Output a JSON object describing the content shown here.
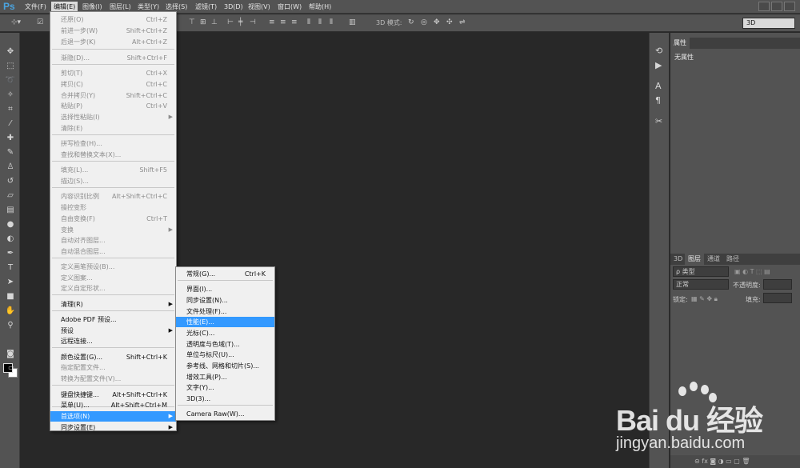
{
  "app": {
    "logo": "Ps"
  },
  "menubar": {
    "items": [
      "文件(F)",
      "编辑(E)",
      "图像(I)",
      "图层(L)",
      "类型(Y)",
      "选择(S)",
      "滤镜(T)",
      "3D(D)",
      "视图(V)",
      "窗口(W)",
      "帮助(H)"
    ],
    "active_index": 1
  },
  "optbar": {
    "mode_label": "3D 模式:",
    "workspace": "3D"
  },
  "panels": {
    "properties_tab": "属性",
    "no_properties": "无属性",
    "layer_tabs": [
      "3D",
      "图层",
      "通道",
      "路径"
    ],
    "layer_tab_active": 1,
    "kind_filter": "ρ 类型",
    "blend_mode": "正常",
    "opacity_label": "不透明度:",
    "lock_label": "锁定:",
    "fill_label": "填充:"
  },
  "edit_menu": {
    "items": [
      {
        "label": "还原(O)",
        "shortcut": "Ctrl+Z",
        "disabled": true
      },
      {
        "label": "前进一步(W)",
        "shortcut": "Shift+Ctrl+Z",
        "disabled": true
      },
      {
        "label": "后退一步(K)",
        "shortcut": "Alt+Ctrl+Z",
        "disabled": true
      },
      {
        "label": "渐隐(D)...",
        "shortcut": "Shift+Ctrl+F",
        "disabled": true
      },
      {
        "label": "剪切(T)",
        "shortcut": "Ctrl+X",
        "disabled": true
      },
      {
        "label": "拷贝(C)",
        "shortcut": "Ctrl+C",
        "disabled": true
      },
      {
        "label": "合并拷贝(Y)",
        "shortcut": "Shift+Ctrl+C",
        "disabled": true
      },
      {
        "label": "粘贴(P)",
        "shortcut": "Ctrl+V",
        "disabled": true
      },
      {
        "label": "选择性粘贴(I)",
        "shortcut": "",
        "disabled": true,
        "submenu": true
      },
      {
        "label": "清除(E)",
        "shortcut": "",
        "disabled": true
      },
      {
        "label": "拼写检查(H)...",
        "shortcut": "",
        "disabled": true
      },
      {
        "label": "查找和替换文本(X)...",
        "shortcut": "",
        "disabled": true
      },
      {
        "label": "填充(L)...",
        "shortcut": "Shift+F5",
        "disabled": true
      },
      {
        "label": "描边(S)...",
        "shortcut": "",
        "disabled": true
      },
      {
        "label": "内容识别比例",
        "shortcut": "Alt+Shift+Ctrl+C",
        "disabled": true
      },
      {
        "label": "操控变形",
        "shortcut": "",
        "disabled": true
      },
      {
        "label": "自由变换(F)",
        "shortcut": "Ctrl+T",
        "disabled": true
      },
      {
        "label": "变换",
        "shortcut": "",
        "disabled": true,
        "submenu": true
      },
      {
        "label": "自动对齐图层...",
        "shortcut": "",
        "disabled": true
      },
      {
        "label": "自动混合图层...",
        "shortcut": "",
        "disabled": true
      },
      {
        "label": "定义画笔预设(B)...",
        "shortcut": "",
        "disabled": true
      },
      {
        "label": "定义图案...",
        "shortcut": "",
        "disabled": true
      },
      {
        "label": "定义自定形状...",
        "shortcut": "",
        "disabled": true
      },
      {
        "label": "清理(R)",
        "shortcut": "",
        "disabled": false,
        "submenu": true
      },
      {
        "label": "Adobe PDF 预设...",
        "shortcut": "",
        "disabled": false
      },
      {
        "label": "预设",
        "shortcut": "",
        "disabled": false,
        "submenu": true
      },
      {
        "label": "远程连接...",
        "shortcut": "",
        "disabled": false
      },
      {
        "label": "颜色设置(G)...",
        "shortcut": "Shift+Ctrl+K",
        "disabled": false
      },
      {
        "label": "指定配置文件...",
        "shortcut": "",
        "disabled": true
      },
      {
        "label": "转换为配置文件(V)...",
        "shortcut": "",
        "disabled": true
      },
      {
        "label": "键盘快捷键...",
        "shortcut": "Alt+Shift+Ctrl+K",
        "disabled": false
      },
      {
        "label": "菜单(U)...",
        "shortcut": "Alt+Shift+Ctrl+M",
        "disabled": false
      },
      {
        "label": "首选项(N)",
        "shortcut": "",
        "disabled": false,
        "submenu": true,
        "highlighted": true
      },
      {
        "label": "同步设置(E)",
        "shortcut": "",
        "disabled": false,
        "submenu": true
      }
    ]
  },
  "prefs_submenu": {
    "items": [
      {
        "label": "常规(G)...",
        "shortcut": "Ctrl+K"
      },
      {
        "label": "界面(I)...",
        "shortcut": ""
      },
      {
        "label": "同步设置(N)...",
        "shortcut": ""
      },
      {
        "label": "文件处理(F)...",
        "shortcut": ""
      },
      {
        "label": "性能(E)...",
        "shortcut": "",
        "highlighted": true
      },
      {
        "label": "光标(C)...",
        "shortcut": ""
      },
      {
        "label": "透明度与色域(T)...",
        "shortcut": ""
      },
      {
        "label": "单位与标尺(U)...",
        "shortcut": ""
      },
      {
        "label": "参考线、网格和切片(S)...",
        "shortcut": ""
      },
      {
        "label": "增效工具(P)...",
        "shortcut": ""
      },
      {
        "label": "文字(Y)...",
        "shortcut": ""
      },
      {
        "label": "3D(3)...",
        "shortcut": ""
      },
      {
        "label": "Camera Raw(W)...",
        "shortcut": ""
      }
    ]
  },
  "watermark": {
    "brand": "Bai du 经验",
    "url": "jingyan.baidu.com"
  },
  "colors": {
    "highlight": "#3399ff",
    "ui_gray": "#535353",
    "canvas": "#282828"
  }
}
